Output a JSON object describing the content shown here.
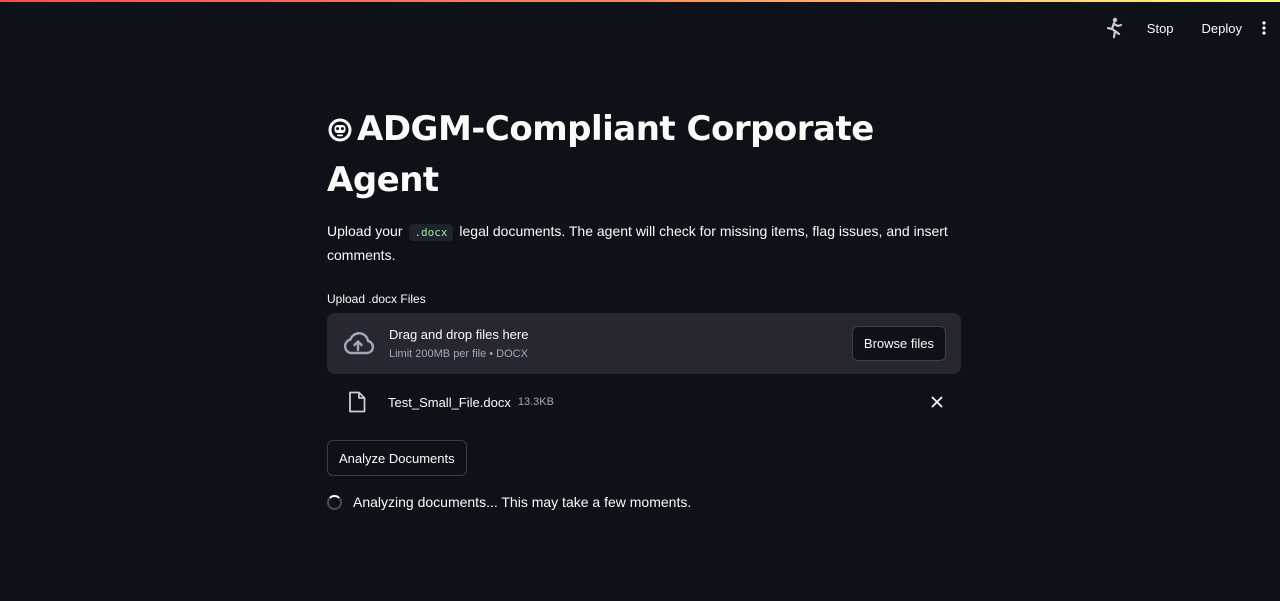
{
  "toolbar": {
    "running_icon": "running-man-icon",
    "stop_label": "Stop",
    "deploy_label": "Deploy",
    "menu_icon": "kebab-menu-icon"
  },
  "title": {
    "emoji_icon": "robot-face-icon",
    "text": "ADGM-Compliant Corporate Agent"
  },
  "description": {
    "before": "Upload your",
    "code": ".docx",
    "after": "legal documents. The agent will check for missing items, flag issues, and insert comments."
  },
  "uploader": {
    "label": "Upload .docx Files",
    "drop_title": "Drag and drop files here",
    "drop_hint": "Limit 200MB per file • DOCX",
    "browse_label": "Browse files",
    "upload_icon": "cloud-upload-icon"
  },
  "uploaded_files": [
    {
      "name": "Test_Small_File.docx",
      "size": "13.3KB",
      "icon": "file-icon"
    }
  ],
  "analyze_button": "Analyze Documents",
  "status": {
    "text": "Analyzing documents... This may take a few moments."
  },
  "colors": {
    "background": "#0e1117",
    "surface": "#262730",
    "text": "#fafafa",
    "muted": "#a3a8b8",
    "code_text": "#a6e3a1"
  }
}
